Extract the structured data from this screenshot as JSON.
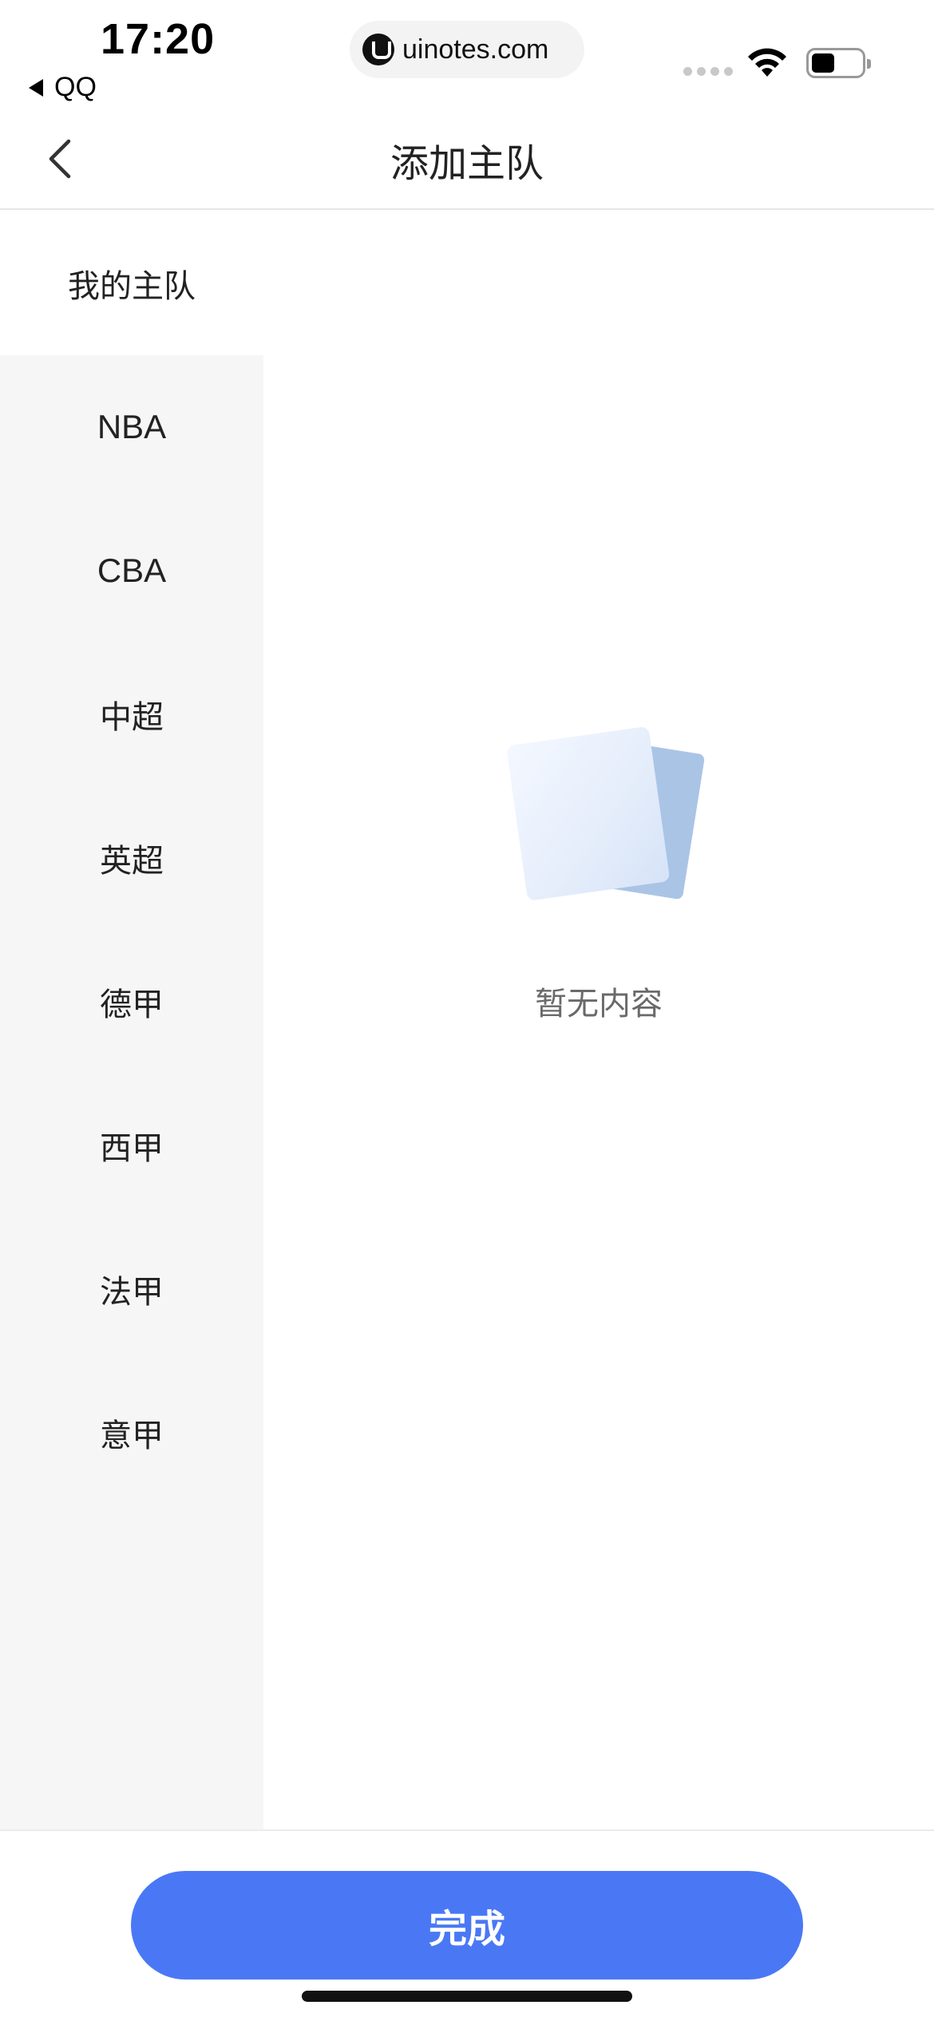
{
  "status_bar": {
    "time": "17:20",
    "back_app": "QQ",
    "url": "uinotes.com",
    "icons": [
      "cellular-signal-icon",
      "wifi-icon",
      "battery-icon"
    ]
  },
  "nav": {
    "title": "添加主队",
    "back_icon": "chevron-left-icon"
  },
  "sidebar": {
    "items": [
      {
        "label": "我的主队",
        "active": true
      },
      {
        "label": "NBA",
        "active": false
      },
      {
        "label": "CBA",
        "active": false
      },
      {
        "label": "中超",
        "active": false
      },
      {
        "label": "英超",
        "active": false
      },
      {
        "label": "德甲",
        "active": false
      },
      {
        "label": "西甲",
        "active": false
      },
      {
        "label": "法甲",
        "active": false
      },
      {
        "label": "意甲",
        "active": false
      }
    ]
  },
  "empty_state": {
    "icon": "empty-documents-icon",
    "text": "暂无内容"
  },
  "footer": {
    "done_label": "完成"
  },
  "colors": {
    "accent": "#4a78f5",
    "sidebar_bg": "#f6f6f6",
    "text_primary": "#222222",
    "text_secondary": "#6a6a6a"
  }
}
